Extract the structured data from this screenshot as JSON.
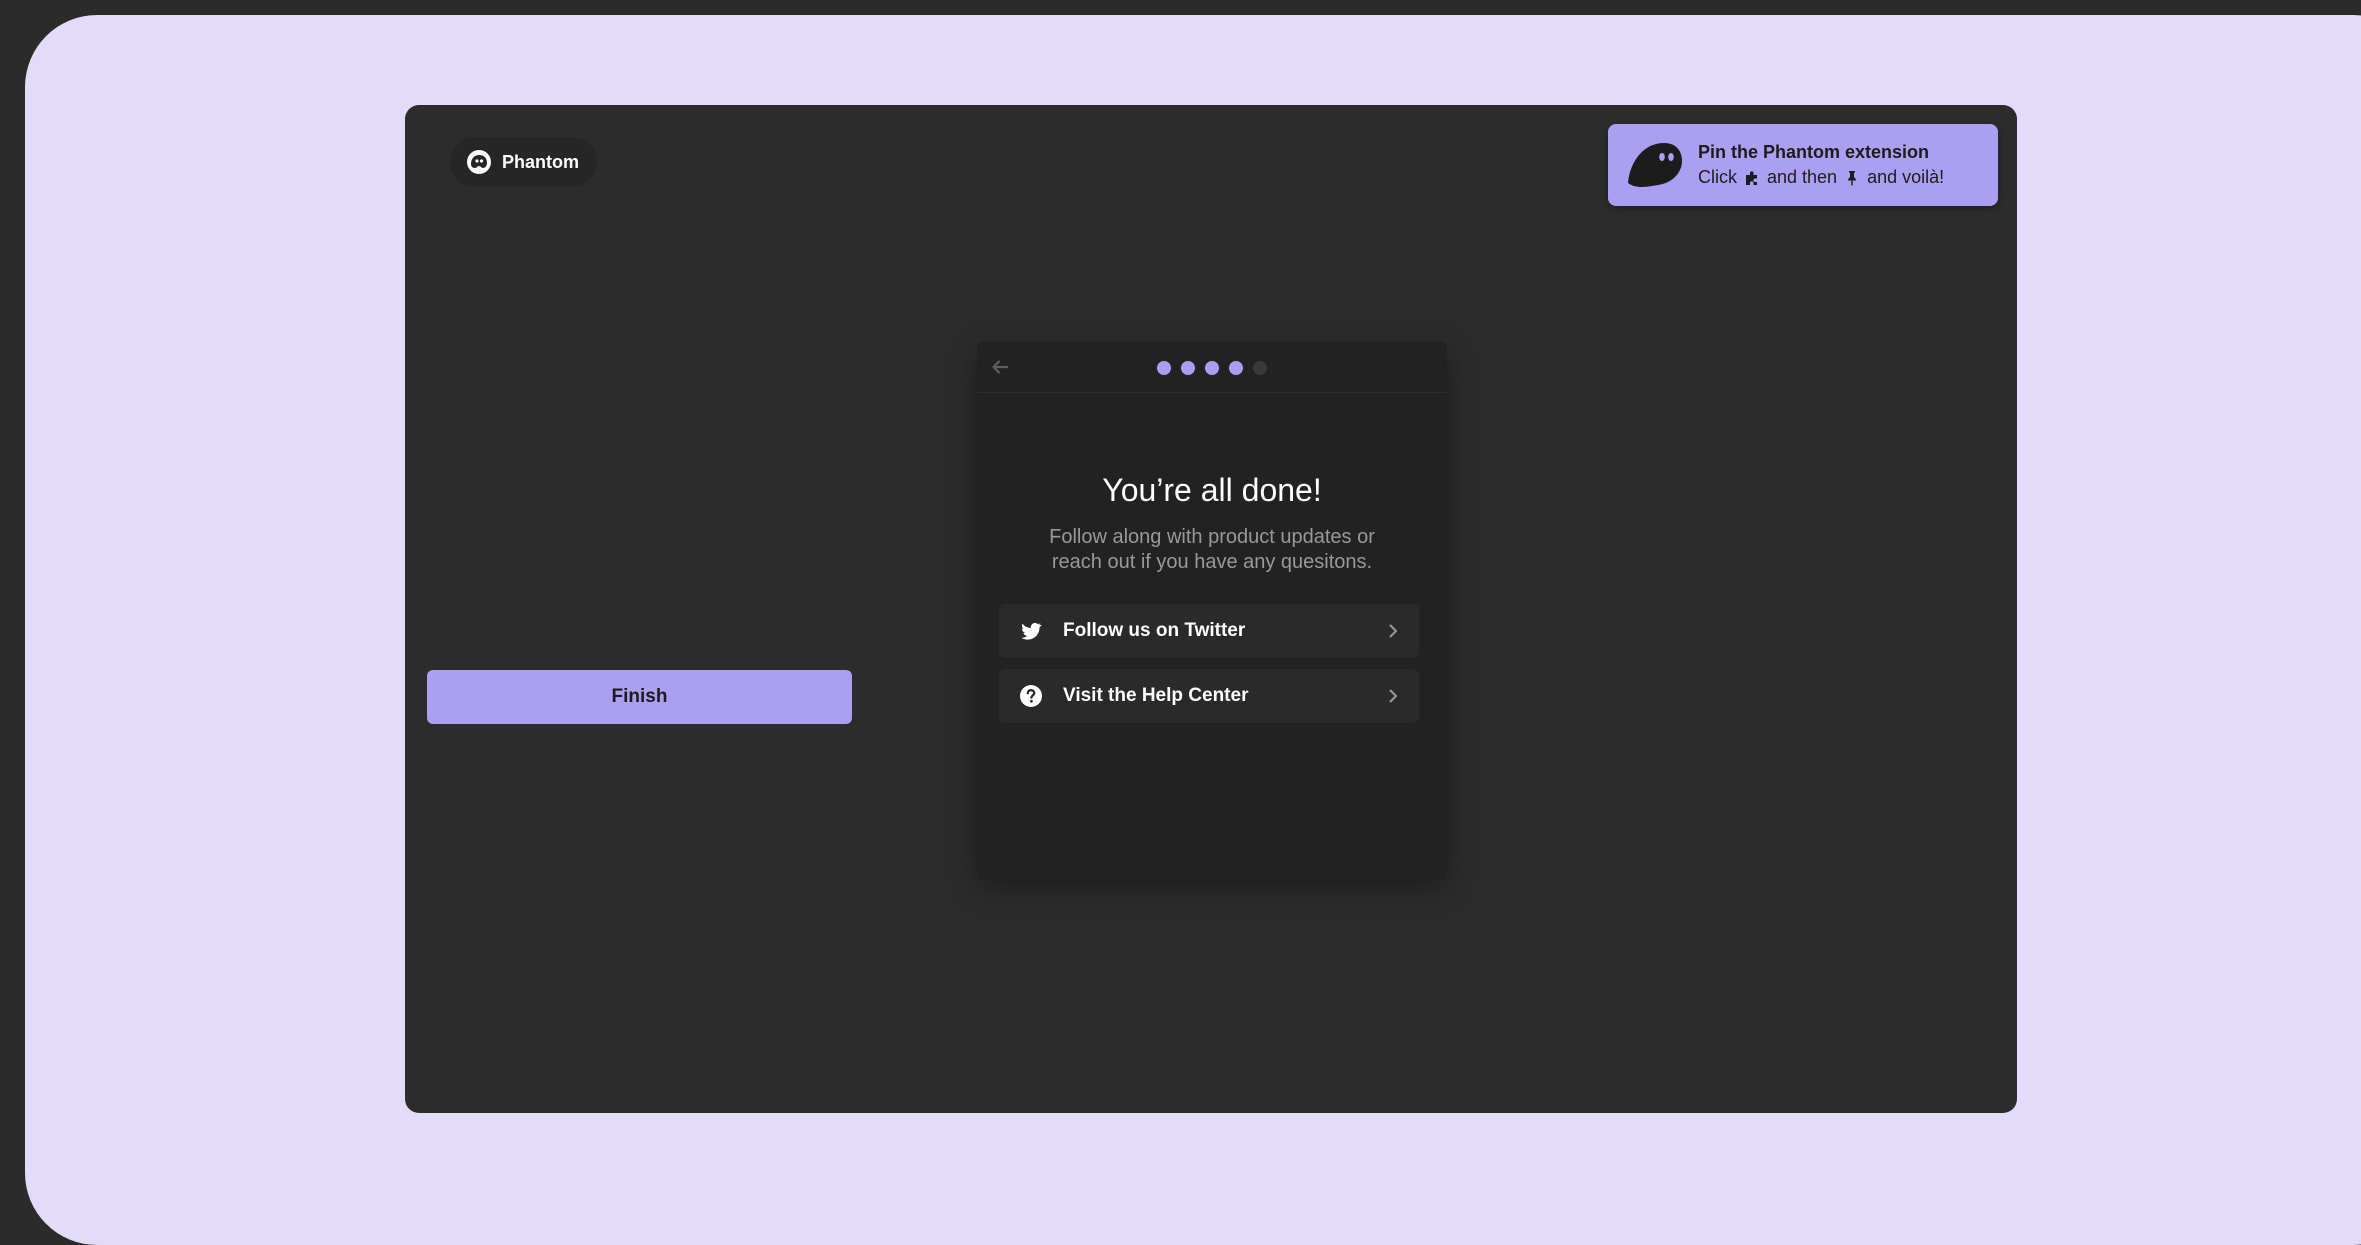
{
  "brand": {
    "name": "Phantom",
    "icon": "phantom-ghost-icon"
  },
  "pin_banner": {
    "title": "Pin the Phantom extension",
    "sub_prefix": "Click",
    "sub_middle": "and then",
    "sub_suffix": "and voilà!",
    "icons": [
      "puzzle-icon",
      "pin-icon"
    ]
  },
  "onboarding": {
    "back_icon": "back-arrow-icon",
    "progress": {
      "total": 5,
      "current": 4
    },
    "title": "You’re all done!",
    "subtitle_line1": "Follow along with product updates or",
    "subtitle_line2": "reach out if you have any quesitons.",
    "links": [
      {
        "label": "Follow us on Twitter",
        "icon": "twitter-icon"
      },
      {
        "label": "Visit the Help Center",
        "icon": "help-circle-icon"
      }
    ],
    "finish_label": "Finish"
  },
  "colors": {
    "accent": "#ab9ff2",
    "background_outer": "#e2dcfa",
    "window": "#2c2c2c",
    "modal": "#222222"
  }
}
